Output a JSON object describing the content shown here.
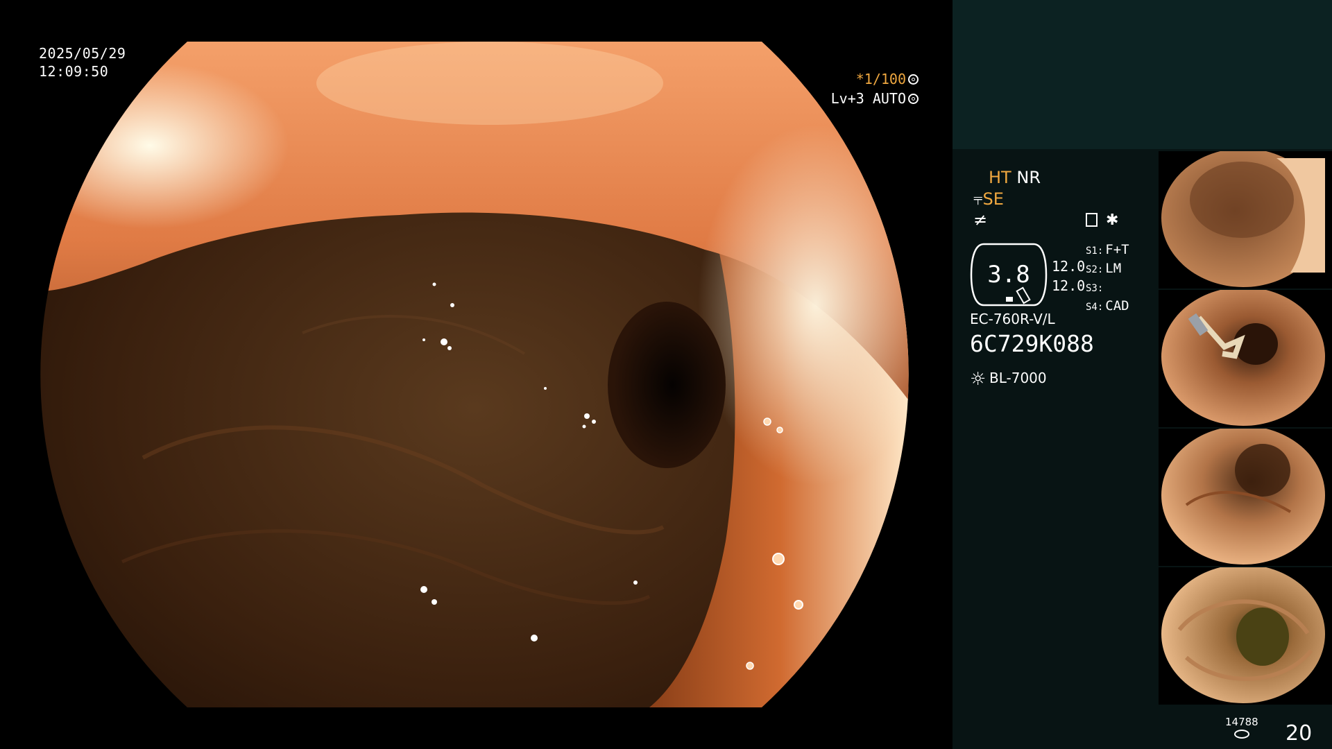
{
  "overlay": {
    "date": "2025/05/29",
    "time": "12:09:50",
    "shutter_speed": "*1/100",
    "level": "Lv+3",
    "iris_mode": "AUTO"
  },
  "side_panel": {
    "ht": "HT",
    "nr": "NR",
    "se": "SE",
    "zoom_value": "3.8",
    "zoom_nums": [
      "12.0",
      "12.0"
    ],
    "s_items": [
      {
        "label": "S1:",
        "value": "F+T"
      },
      {
        "label": "S2:",
        "value": "LM"
      },
      {
        "label": "S3:",
        "value": ""
      },
      {
        "label": "S4:",
        "value": "CAD"
      }
    ],
    "scope_model": "EC-760R-V/L",
    "scope_serial": "6C729K088",
    "light_source": "BL-7000",
    "image_count_small": "14788",
    "image_count_big": "20"
  },
  "thumbnails": [
    {
      "label": "thumbnail-1",
      "lumen": "left-wall"
    },
    {
      "label": "thumbnail-2",
      "lumen": "with-tool"
    },
    {
      "label": "thumbnail-3",
      "lumen": "center-right"
    },
    {
      "label": "thumbnail-4",
      "lumen": "deep-center"
    }
  ],
  "colors": {
    "accent_amber": "#f0a840",
    "panel_bg": "#081414",
    "panel_top_bg": "#0c2222"
  }
}
